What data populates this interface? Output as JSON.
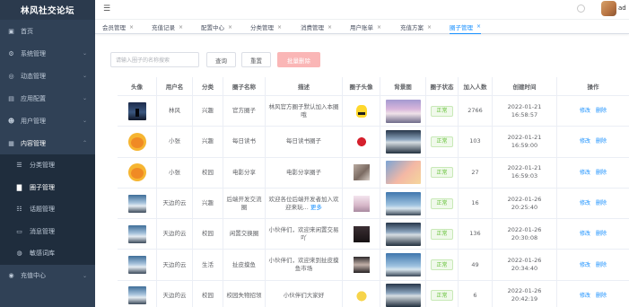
{
  "app": {
    "title": "林风社交论坛"
  },
  "topbar": {
    "username": "ad"
  },
  "sidebar": {
    "items": [
      {
        "label": "首页",
        "icon": "dashboard-icon"
      },
      {
        "label": "系统管理",
        "icon": "settings-icon"
      },
      {
        "label": "动态管理",
        "icon": "timeline-icon"
      },
      {
        "label": "应用配置",
        "icon": "app-icon"
      },
      {
        "label": "用户管理",
        "icon": "user-icon"
      },
      {
        "label": "内容管理",
        "icon": "content-icon"
      }
    ],
    "submenu": [
      {
        "label": "分类管理",
        "icon": "category-icon"
      },
      {
        "label": "圈子管理",
        "icon": "circle-icon"
      },
      {
        "label": "话题管理",
        "icon": "topic-icon"
      },
      {
        "label": "消息管理",
        "icon": "message-icon"
      },
      {
        "label": "敏感词库",
        "icon": "shield-icon"
      }
    ],
    "after": [
      {
        "label": "充值中心",
        "icon": "wallet-icon"
      }
    ]
  },
  "tabs": [
    {
      "label": "会员管理"
    },
    {
      "label": "充值记录"
    },
    {
      "label": "配置中心"
    },
    {
      "label": "分类管理"
    },
    {
      "label": "消费管理"
    },
    {
      "label": "用户账单"
    },
    {
      "label": "充值方案"
    },
    {
      "label": "圈子管理"
    }
  ],
  "toolbar": {
    "search_placeholder": "请输入圈子的名称搜索",
    "query_label": "查询",
    "reset_label": "重置",
    "batch_delete_label": "批量删除"
  },
  "table": {
    "headers": [
      "头像",
      "用户名",
      "分类",
      "圈子名称",
      "描述",
      "圈子头像",
      "背景图",
      "圈子状态",
      "加入人数",
      "创建时间",
      "操作"
    ],
    "rows": [
      {
        "username": "林风",
        "category": "兴趣",
        "name": "官方圈子",
        "desc": "林风官方圈子默认加入本圈哦",
        "status": "正常",
        "members": "2766",
        "created": "2022-01-21 16:58:57"
      },
      {
        "username": "小张",
        "category": "兴趣",
        "name": "每日读书",
        "desc": "每日读书圈子",
        "status": "正常",
        "members": "103",
        "created": "2022-01-21 16:59:00"
      },
      {
        "username": "小张",
        "category": "校园",
        "name": "电影分享",
        "desc": "电影分享圈子",
        "status": "正常",
        "members": "27",
        "created": "2022-01-21 16:59:03"
      },
      {
        "username": "天边的云",
        "category": "兴趣",
        "name": "后端开发交流圈",
        "desc": "欢迎各位后端开发者加入欢迎来玩...",
        "more": "更多",
        "status": "正常",
        "members": "16",
        "created": "2022-01-26 20:25:40"
      },
      {
        "username": "天边的云",
        "category": "校园",
        "name": "闲置交换圈",
        "desc": "小伙伴们，欢迎来闲置交易吖",
        "status": "正常",
        "members": "136",
        "created": "2022-01-26 20:30:08"
      },
      {
        "username": "天边的云",
        "category": "生活",
        "name": "扯皮摸鱼",
        "desc": "小伙伴们，欢迎来到扯皮摸鱼市场",
        "status": "正常",
        "members": "49",
        "created": "2022-01-26 20:34:40"
      },
      {
        "username": "天边的云",
        "category": "校园",
        "name": "校园失物招领",
        "desc": "小伙伴们大家好",
        "status": "正常",
        "members": "6",
        "created": "2022-01-26 20:42:19"
      }
    ],
    "actions": {
      "edit": "修改",
      "delete": "删除"
    }
  }
}
